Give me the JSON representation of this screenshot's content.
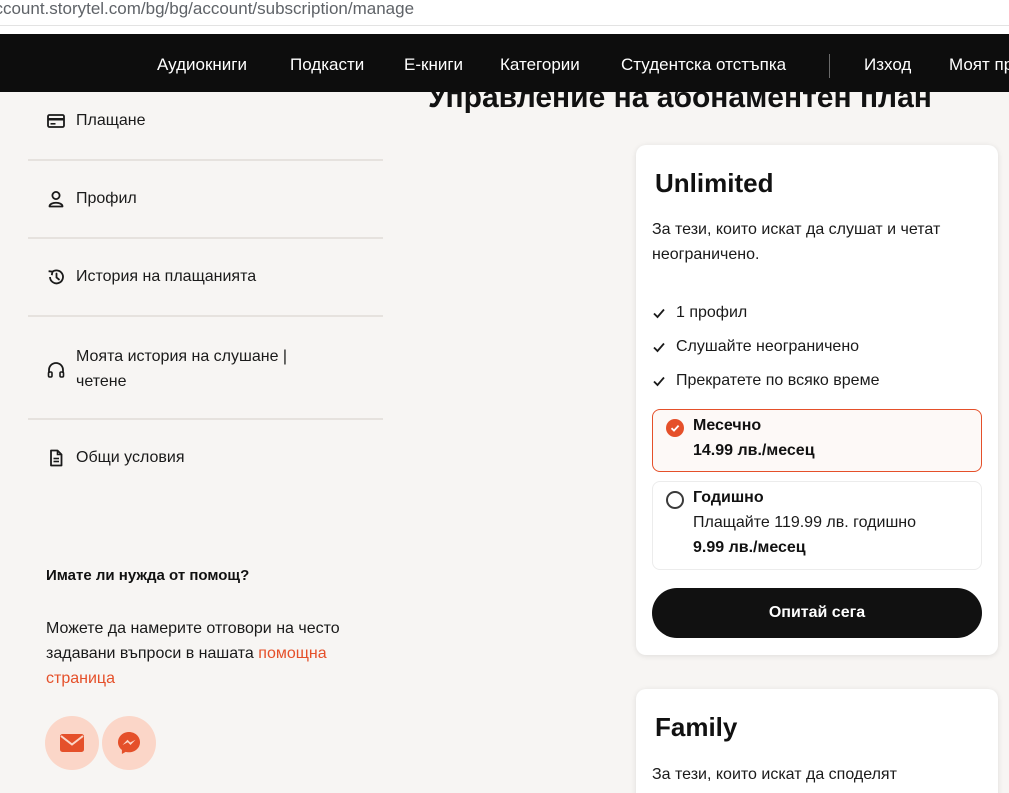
{
  "browser": {
    "url": "account.storytel.com/bg/bg/account/subscription/manage"
  },
  "nav": {
    "items": [
      "Аудиокниги",
      "Подкасти",
      "Е-книги",
      "Категории",
      "Студентска отстъпка"
    ],
    "logout": "Изход",
    "account": "Моят профил"
  },
  "sidebar": {
    "items": [
      {
        "label": "Плащане",
        "icon": "credit-card-icon"
      },
      {
        "label": "Профил",
        "icon": "user-icon"
      },
      {
        "label": "История на плащанията",
        "icon": "history-icon"
      },
      {
        "label_line1": "Моята история на слушане |",
        "label_line2": "четене",
        "icon": "headphones-icon"
      },
      {
        "label": "Общи условия",
        "icon": "document-icon"
      }
    ]
  },
  "help": {
    "title": "Имате ли нужда от помощ?",
    "text": "Можете да намерите отговори на често задавани въпроси в нашата",
    "link": "помощна страница",
    "buttons": [
      {
        "icon": "envelope-icon"
      },
      {
        "icon": "messenger-icon"
      }
    ]
  },
  "main": {
    "heading": "Управление на абонаментен план",
    "plans": [
      {
        "title": "Unlimited",
        "description": "За тези, които искат да слушат и четат неограничено.",
        "features": [
          "1 профил",
          "Слушайте неограничено",
          "Прекратете по всяко време"
        ],
        "options": [
          {
            "name": "Месечно",
            "price": "14.99 лв./месец",
            "selected": true
          },
          {
            "name": "Годишно",
            "note": "Плащайте 119.99 лв. годишно",
            "price": "9.99 лв./месец",
            "selected": false
          }
        ],
        "cta": "Опитай сега"
      },
      {
        "title": "Family",
        "description": "За тези, които искат да споделят"
      }
    ]
  },
  "colors": {
    "accent": "#e5502a",
    "nav_bg": "#0d0d0d",
    "page_bg": "#f7f5f3",
    "help_circle": "#fbd6c8"
  }
}
